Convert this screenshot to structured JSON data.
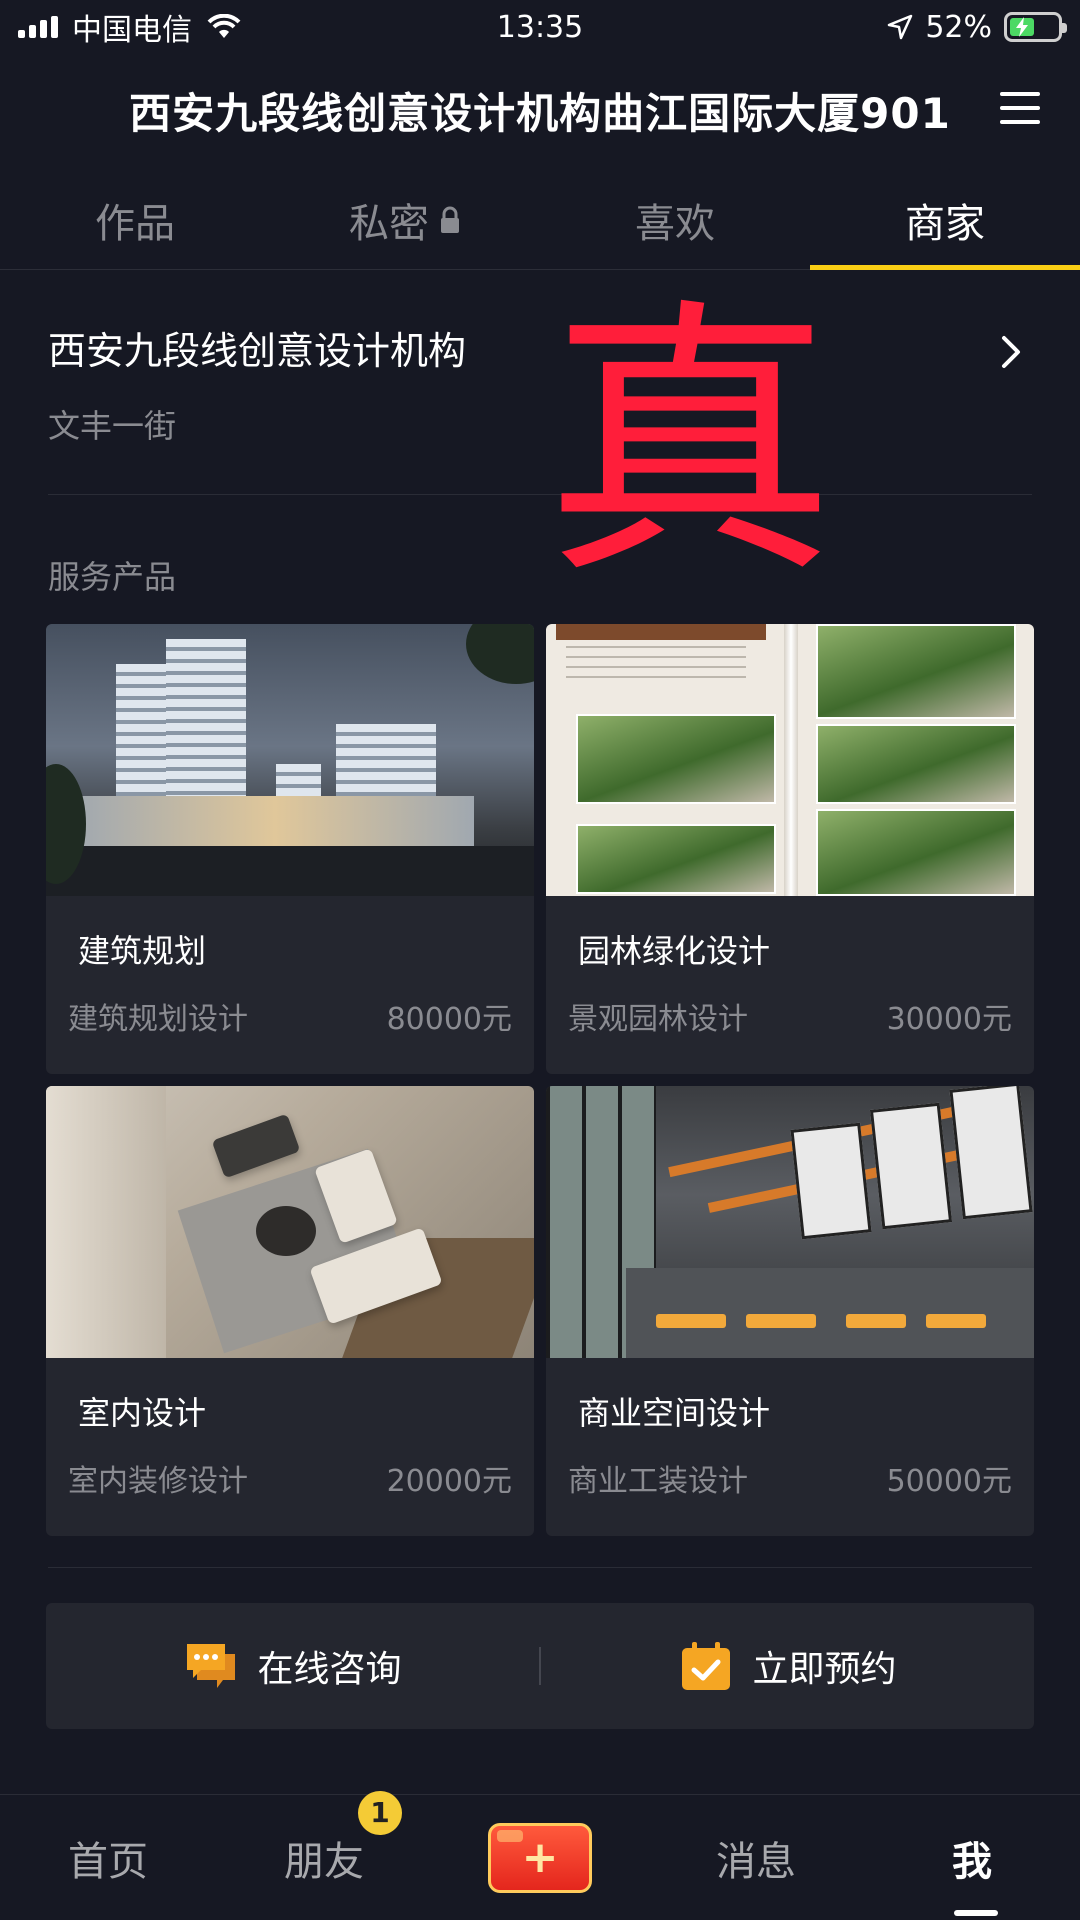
{
  "status_bar": {
    "carrier": "中国电信",
    "time": "13:35",
    "battery": "52%",
    "battery_level": 0.52
  },
  "header": {
    "title": "西安九段线创意设计机构曲江国际大厦901"
  },
  "tabs": [
    {
      "label": "作品"
    },
    {
      "label": "私密"
    },
    {
      "label": "喜欢"
    },
    {
      "label": "商家"
    }
  ],
  "merchant": {
    "name": "西安九段线创意设计机构",
    "address": "文丰一街"
  },
  "watermark": "真",
  "section_title": "服务产品",
  "products": [
    {
      "name": "建筑规划",
      "subtitle": "建筑规划设计",
      "price": "80000元"
    },
    {
      "name": "园林绿化设计",
      "subtitle": "景观园林设计",
      "price": "30000元"
    },
    {
      "name": "室内设计",
      "subtitle": "室内装修设计",
      "price": "20000元"
    },
    {
      "name": "商业空间设计",
      "subtitle": "商业工装设计",
      "price": "50000元"
    }
  ],
  "actions": {
    "consult": "在线咨询",
    "book": "立即预约"
  },
  "bottom_nav": [
    {
      "label": "首页"
    },
    {
      "label": "朋友",
      "badge": "1"
    },
    {
      "label": "+"
    },
    {
      "label": "消息"
    },
    {
      "label": "我"
    }
  ],
  "colors": {
    "background": "#161823",
    "accent": "#face15",
    "card": "#24262f",
    "icon_orange": "#f5a623"
  }
}
